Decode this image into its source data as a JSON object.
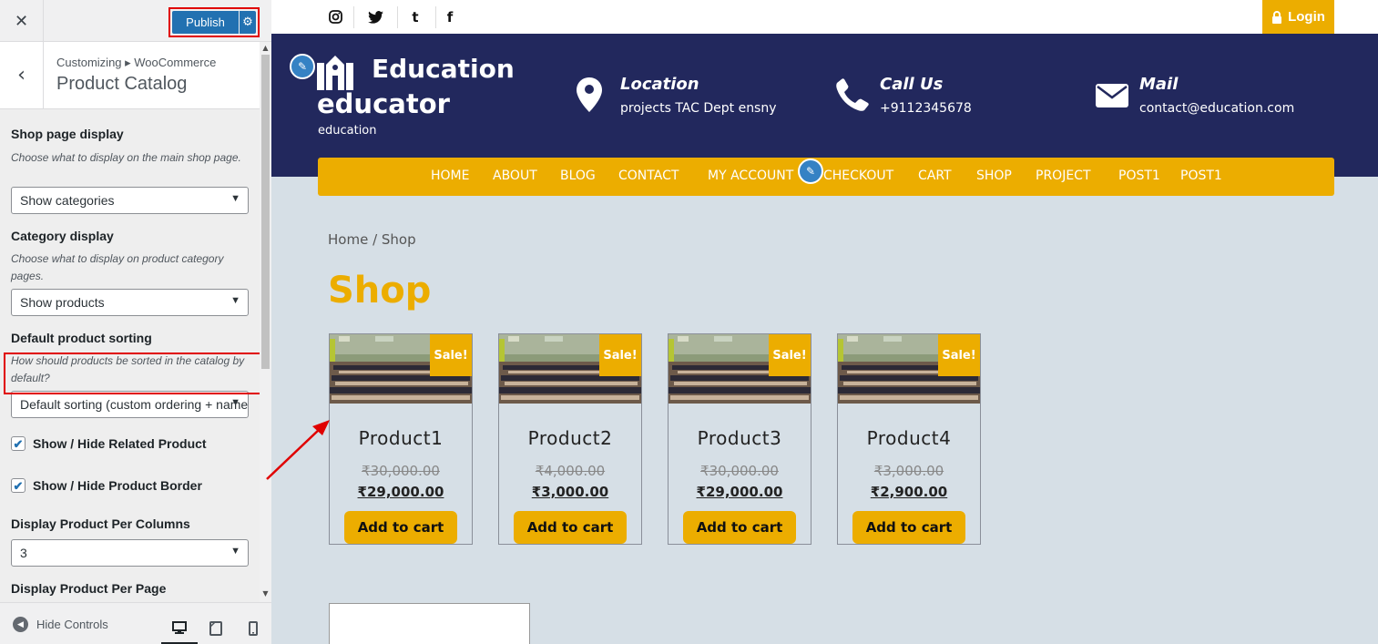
{
  "customizer": {
    "close_icon": "close-icon",
    "publish_label": "Publish",
    "breadcrumb": "Customizing ▸ WooCommerce",
    "section_title": "Product Catalog",
    "controls": {
      "shop_page_display": {
        "title": "Shop page display",
        "description": "Choose what to display on the main shop page.",
        "value": "Show categories"
      },
      "category_display": {
        "title": "Category display",
        "description": "Choose what to display on product category pages.",
        "value": "Show products"
      },
      "default_sorting": {
        "title": "Default product sorting",
        "description": "How should products be sorted in the catalog by default?",
        "value": "Default sorting (custom ordering + name)"
      },
      "related_product": {
        "label": "Show / Hide Related Product",
        "checked": true
      },
      "product_border": {
        "label": "Show / Hide Product Border",
        "checked": true
      },
      "per_columns": {
        "title": "Display Product Per Columns",
        "value": "3"
      },
      "per_page": {
        "title": "Display Product Per Page"
      }
    },
    "footer": {
      "hide_controls": "Hide Controls",
      "active_device": "desktop"
    }
  },
  "site": {
    "social_icons": [
      "instagram-icon",
      "twitter-icon",
      "tumblr-icon",
      "facebook-icon"
    ],
    "login_label": "Login",
    "logo_line1": "Education",
    "logo_line2": "educator",
    "tagline": "education",
    "contacts": [
      {
        "icon": "map-pin-icon",
        "title": "Location",
        "text": "projects TAC Dept ensny"
      },
      {
        "icon": "phone-icon",
        "title": "Call Us",
        "text": "+9112345678"
      },
      {
        "icon": "mail-icon",
        "title": "Mail",
        "text": "contact@education.com"
      }
    ],
    "nav": [
      "HOME",
      "ABOUT",
      "BLOG",
      "CONTACT",
      "MY ACCOUNT",
      "CHECKOUT",
      "CART",
      "SHOP",
      "PROJECT",
      "POST1",
      "POST1"
    ],
    "breadcrumb": "Home / Shop",
    "page_title": "Shop",
    "sale_badge": "Sale!",
    "add_to_cart": "Add to cart",
    "products": [
      {
        "name": "Product1",
        "old_price": "₹30,000.00",
        "price": "₹29,000.00"
      },
      {
        "name": "Product2",
        "old_price": "₹4,000.00",
        "price": "₹3,000.00"
      },
      {
        "name": "Product3",
        "old_price": "₹30,000.00",
        "price": "₹29,000.00"
      },
      {
        "name": "Product4",
        "old_price": "₹3,000.00",
        "price": "₹2,900.00"
      }
    ]
  },
  "colors": {
    "accent": "#ecad00",
    "header_bg": "#22285d",
    "preview_bg": "#d6dfe6",
    "wp_blue": "#2271b1",
    "highlight_red": "#e00000"
  }
}
